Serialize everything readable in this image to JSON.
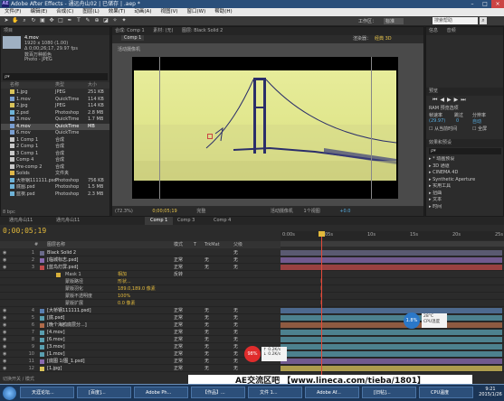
{
  "window": {
    "title": "Adobe After Effects - 通远舟山02 | 已储存 | .aep *",
    "app_icon": "AE"
  },
  "menu": [
    "文件(F)",
    "编辑(E)",
    "合成(C)",
    "图层(L)",
    "效果(T)",
    "动画(A)",
    "视图(V)",
    "窗口(W)",
    "帮助(H)"
  ],
  "workspace": {
    "label": "工作区：",
    "value": "标准",
    "search_placeholder": "搜索帮助"
  },
  "project": {
    "tab": "项目",
    "selected_name": "4.mov",
    "info": [
      "1920 x 1080 (1.00)",
      "Δ 0;00;26;17, 29.97 fps",
      "数百万种颜色",
      "Photo - JPEG"
    ],
    "search_placeholder": "ρ▾",
    "columns": [
      "名称",
      "类型",
      "大小"
    ],
    "items": [
      {
        "name": "1.jpg",
        "type": "JPEG",
        "size": "251 KB",
        "color": "#d9c35a"
      },
      {
        "name": "1.mov",
        "type": "QuickTime",
        "size": "114 KB",
        "color": "#7a9fd1"
      },
      {
        "name": "2.jpg",
        "type": "JPEG",
        "size": "114 KB",
        "color": "#d9c35a"
      },
      {
        "name": "2.psd",
        "type": "Photoshop",
        "size": "2.8 MB",
        "color": "#6fb3d8"
      },
      {
        "name": "3.mov",
        "type": "QuickTime",
        "size": "1.7 MB",
        "color": "#7a9fd1"
      },
      {
        "name": "4.mov",
        "type": "QuickTime",
        "size": "MB",
        "color": "#7a9fd1",
        "selected": true
      },
      {
        "name": "6.mov",
        "type": "QuickTime",
        "size": "",
        "color": "#7a9fd1"
      },
      {
        "name": "1 Comp 1",
        "type": "合成",
        "size": "",
        "color": "#c9c9c9"
      },
      {
        "name": "2 Comp 1",
        "type": "合成",
        "size": "",
        "color": "#c9c9c9"
      },
      {
        "name": "3 Comp 1",
        "type": "合成",
        "size": "",
        "color": "#c9c9c9"
      },
      {
        "name": "Comp 4",
        "type": "合成",
        "size": "",
        "color": "#c9c9c9"
      },
      {
        "name": "Pre-comp 2",
        "type": "合成",
        "size": "",
        "color": "#c9c9c9"
      },
      {
        "name": "Solids",
        "type": "文件夹",
        "size": "",
        "color": "#e0b84a"
      },
      {
        "name": "大桥钢111111.psd",
        "type": "Photoshop",
        "size": "756 KB",
        "color": "#6fb3d8"
      },
      {
        "name": "底图.psd",
        "type": "Photoshop",
        "size": "1.5 MB",
        "color": "#6fb3d8"
      },
      {
        "name": "蓝夜.psd",
        "type": "Photoshop",
        "size": "2.3 MB",
        "color": "#6fb3d8"
      }
    ],
    "footer": "8 bpc"
  },
  "composition": {
    "tabs": [
      "合成: Comp 1",
      "素材: (无)",
      "图层: Black Solid 2"
    ],
    "breadcrumb": "Comp 1",
    "renderer_label": "渲染器：",
    "renderer": "经典 3D",
    "viewer_label": "活动摄像机",
    "bottom": {
      "zoom": "(72.3%)",
      "time": "0;00;05;19",
      "quality": "完整",
      "view": "活动摄像机",
      "views": "1个视图",
      "exposure": "+0.0"
    }
  },
  "right_panels": {
    "info_tab": "信息",
    "audio_tab": "音频",
    "preview_tab": "预览",
    "ram_label": "RAM 预览选项",
    "frame_rate_label": "帧速率",
    "skip_label": "跳过",
    "resolution_label": "分辨率",
    "frame_rate": "(29.97)",
    "skip": "0",
    "resolution": "自动",
    "from_current": "从当前时间",
    "fullscreen": "全屏",
    "effects_tab": "效果和预设",
    "effects_search": "ρ▾",
    "effects": [
      "* 动画预设",
      "3D 通道",
      "CINEMA 4D",
      "Synthetic Aperture",
      "实用工具",
      "扭曲",
      "文本",
      "时间"
    ]
  },
  "timeline": {
    "tabs": [
      "通元舟山11",
      "通元舟山11",
      "Comp 1",
      "Comp 3",
      "Comp 4"
    ],
    "timecode": "0;00;05;19",
    "columns": [
      "#",
      "图层名称",
      "模式",
      "T",
      "TrkMat",
      "父级"
    ],
    "ruler": [
      "0:00s",
      "05s",
      "10s",
      "15s",
      "20s",
      "25s"
    ],
    "layers": [
      {
        "num": "1",
        "name": "Black Solid 2",
        "color": "#6b6b8a",
        "mode": "",
        "trk": "",
        "parent": "无"
      },
      {
        "num": "2",
        "name": "[临城标志.psd]",
        "color": "#8a6bb0",
        "mode": "正常",
        "trk": "无",
        "parent": "无"
      },
      {
        "num": "3",
        "name": "[蓝鸟灯屏.psd]",
        "color": "#c04a4a",
        "mode": "正常",
        "trk": "无",
        "parent": "无"
      },
      {
        "num": "",
        "name": "Mask 1",
        "color": "#d8b03a",
        "mode": "相加",
        "trk": "反转",
        "parent": ""
      },
      {
        "num": "",
        "name": "蒙版路径",
        "color": "",
        "mode": "形状...",
        "trk": "",
        "parent": ""
      },
      {
        "num": "",
        "name": "蒙版羽化",
        "color": "",
        "mode": "189.0,189.0 像素",
        "trk": "",
        "parent": ""
      },
      {
        "num": "",
        "name": "蒙版不透明度",
        "color": "",
        "mode": "100%",
        "trk": "",
        "parent": ""
      },
      {
        "num": "",
        "name": "蒙版扩展",
        "color": "",
        "mode": "0.0 像素",
        "trk": "",
        "parent": ""
      },
      {
        "num": "4",
        "name": "[大桥钢111111.psd]",
        "color": "#5a7fb0",
        "mode": "正常",
        "trk": "无",
        "parent": "无"
      },
      {
        "num": "5",
        "name": "[底.psd]",
        "color": "#5a9fb0",
        "mode": "正常",
        "trk": "无",
        "parent": "无"
      },
      {
        "num": "6",
        "name": "[晚个海鸥底层分...]",
        "color": "#b06b4a",
        "mode": "正常",
        "trk": "无",
        "parent": "无"
      },
      {
        "num": "7",
        "name": "[4.mov]",
        "color": "#5a9fb0",
        "mode": "正常",
        "trk": "无",
        "parent": "无"
      },
      {
        "num": "8",
        "name": "[6.mov]",
        "color": "#5a9fb0",
        "mode": "正常",
        "trk": "无",
        "parent": "无"
      },
      {
        "num": "9",
        "name": "[3.mov]",
        "color": "#5a9fb0",
        "mode": "正常",
        "trk": "无",
        "parent": "无"
      },
      {
        "num": "10",
        "name": "[1.mov]",
        "color": "#5a9fb0",
        "mode": "正常",
        "trk": "无",
        "parent": "无"
      },
      {
        "num": "11",
        "name": "[底图 1/图_1.psd]",
        "color": "#8a6bb0",
        "mode": "正常",
        "trk": "无",
        "parent": "无"
      },
      {
        "num": "12",
        "name": "[1.jpg]",
        "color": "#d9c35a",
        "mode": "正常",
        "trk": "无",
        "parent": "无"
      }
    ],
    "footer": "切换开关 / 模式"
  },
  "overlays": {
    "cpu_blue": "1.8%",
    "cpu_blue_temp": "28°C",
    "cpu_blue_label": "CPU温度",
    "cpu_red": "98%",
    "net_up": "0.2K/s",
    "net_down": "0.2K/s",
    "banner": "AE交流区吧 【www.lineca.com/tieba/1801】"
  },
  "taskbar": {
    "items": [
      "天涯论坛...",
      "[百度]...",
      "Adobe Ph...",
      "【作品】...",
      "文件 1...",
      "Adobe Af...",
      "[旧帖]...",
      "CPU温度"
    ],
    "clock_time": "9:21",
    "clock_date": "2015/1/26"
  }
}
